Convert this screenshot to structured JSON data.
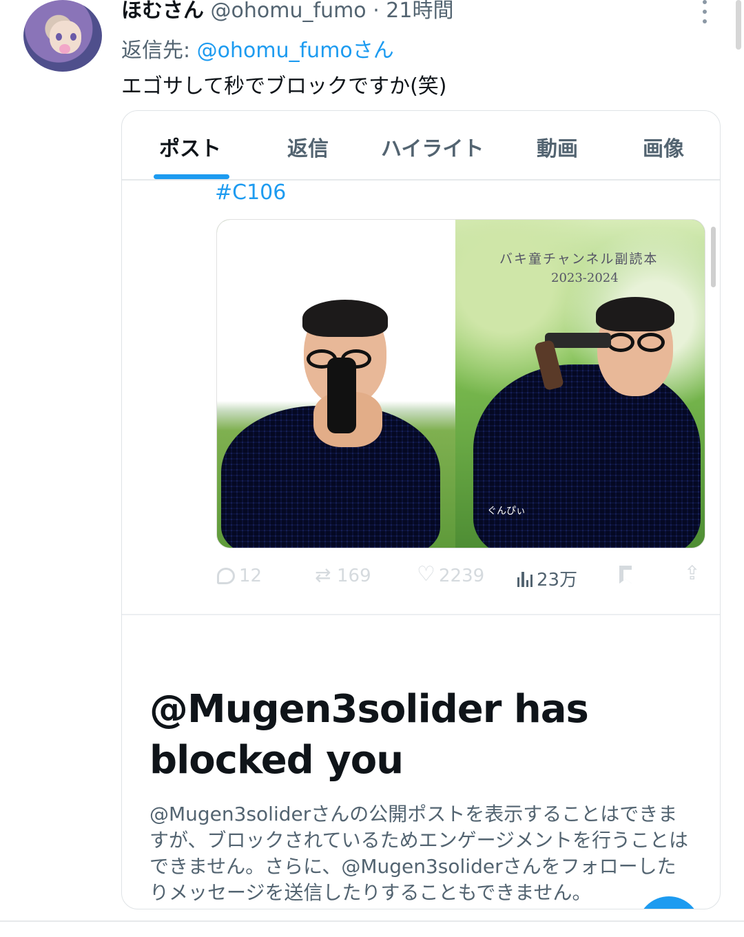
{
  "tweet": {
    "display_name": "ほむさん",
    "handle_time": "@ohomu_fumo · 21時間",
    "reply_prefix": "返信先: ",
    "reply_handle": "@ohomu_fumoさん",
    "text": "エゴサして秒でブロックですか(笑)"
  },
  "embedded": {
    "tabs": [
      {
        "label": "ポスト",
        "active": true
      },
      {
        "label": "返信",
        "active": false
      },
      {
        "label": "ハイライト",
        "active": false
      },
      {
        "label": "動画",
        "active": false
      },
      {
        "label": "画像",
        "active": false
      }
    ],
    "hashtag": "#C106",
    "photo": {
      "title": "バキ童チャンネル副読本",
      "years": "2023-2024",
      "author": "ぐんぴぃ"
    },
    "actions": {
      "replies": "12",
      "reposts": "169",
      "likes": "2239",
      "views": "23万"
    },
    "blocked": {
      "title": "@Mugen3solider has blocked you",
      "description": "@Mugen3soliderさんの公開ポストを表示することはできますが、ブロックされているためエンゲージメントを行うことはできません。さらに、@Mugen3soliderさんをフォローしたりメッセージを送信したりすることもできません。"
    }
  },
  "colors": {
    "accent": "#1d9bf0",
    "muted_text": "#536471",
    "text": "#0f1419"
  }
}
